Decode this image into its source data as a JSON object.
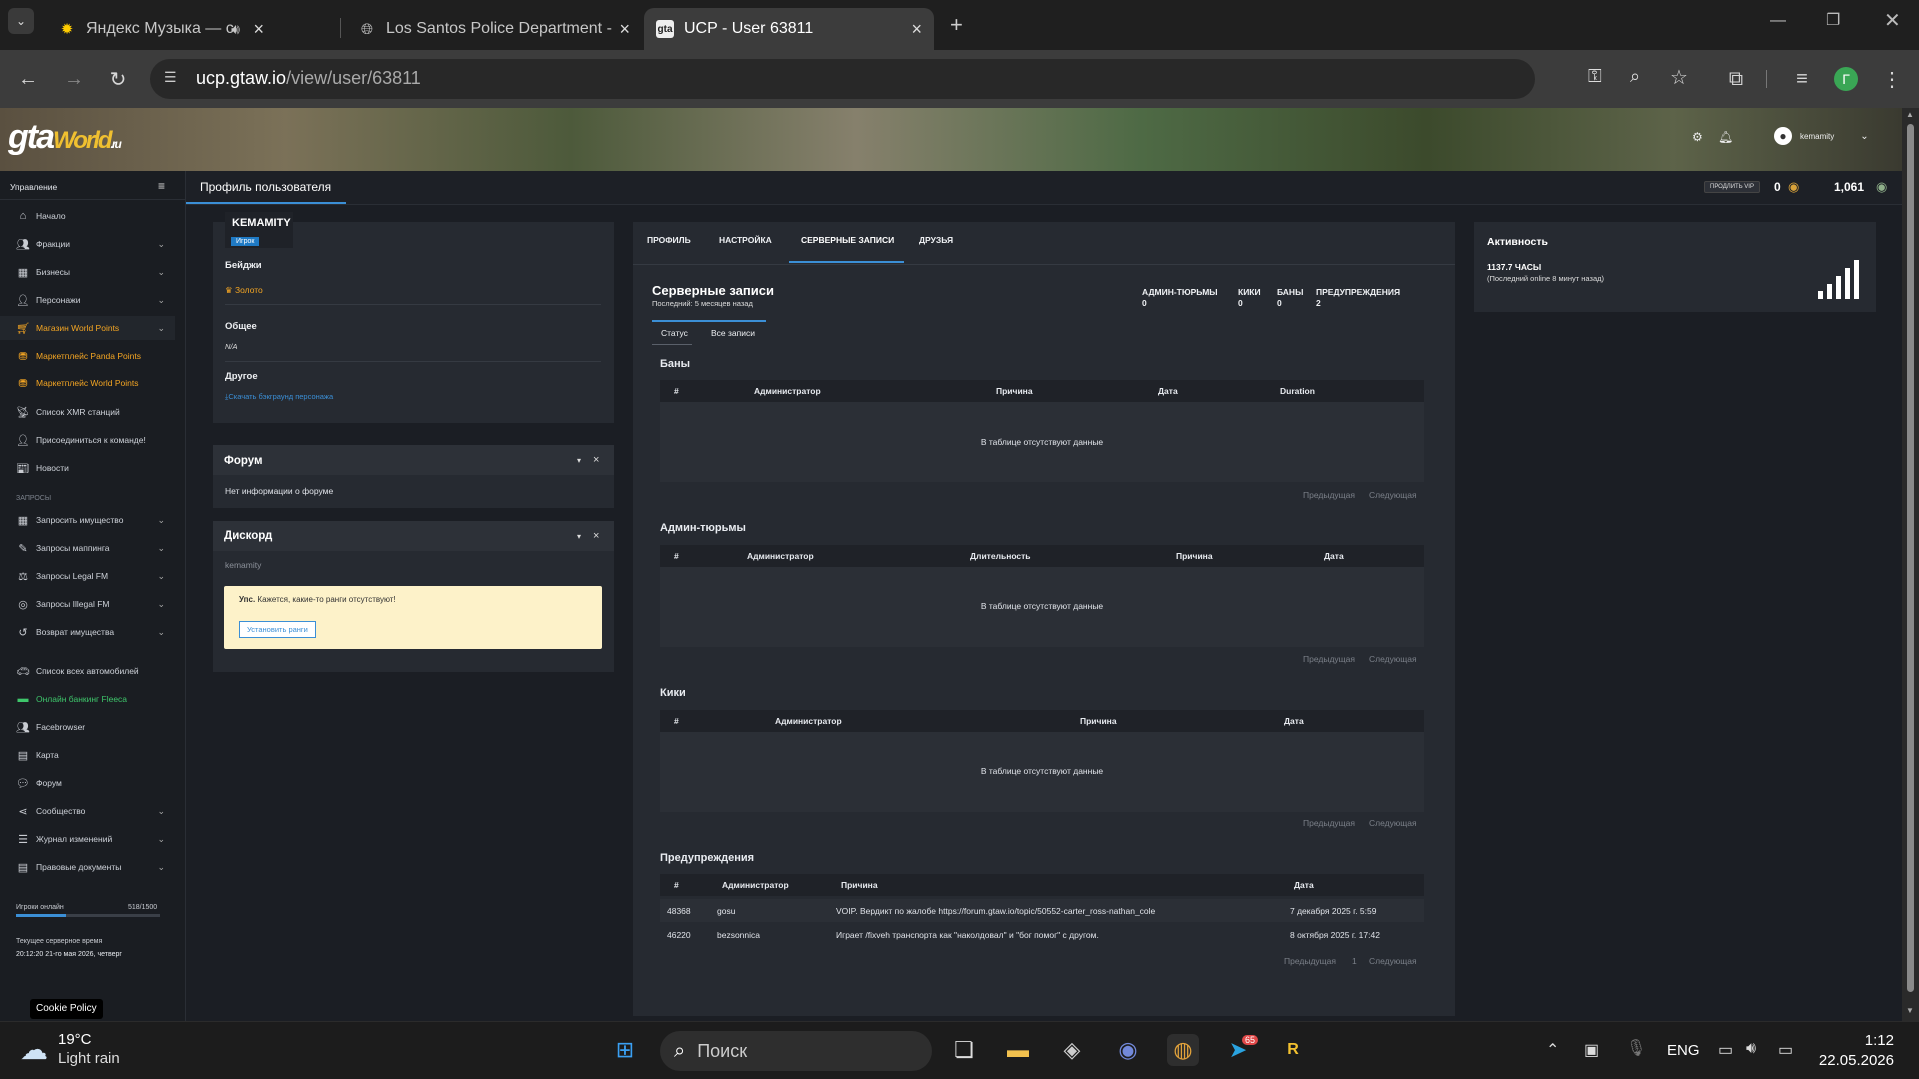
{
  "browser": {
    "tabs": [
      {
        "title": "Яндекс Музыка — собирае",
        "icon": "yandex-music-icon",
        "audio": true
      },
      {
        "title": "Los Santos Police Department -",
        "icon": "globe-icon"
      },
      {
        "title": "UCP - User 63811",
        "icon": "gta-world-icon",
        "active": true
      }
    ],
    "url_host": "ucp.gtaw.io",
    "url_path": "/view/user/63811",
    "profile_initial": "Г"
  },
  "banner": {
    "logo_main": "gta",
    "logo_sub": "World",
    "logo_tld": ".ru",
    "user_name": "kemamity"
  },
  "sidebar": {
    "header": "Управление",
    "items": [
      {
        "label": "Начало",
        "icon": "home-icon"
      },
      {
        "label": "Фракции",
        "icon": "users-icon",
        "chevron": true
      },
      {
        "label": "Бизнесы",
        "icon": "building-icon",
        "chevron": true
      },
      {
        "label": "Персонажи",
        "icon": "user-icon",
        "chevron": true
      },
      {
        "label": "Магазин World Points",
        "icon": "cart-icon",
        "chevron": true
      },
      {
        "label": "Маркетплейс Panda Points",
        "icon": "coins-icon"
      },
      {
        "label": "Маркетплейс World Points",
        "icon": "coins-icon"
      },
      {
        "label": "Список ХМR станций",
        "icon": "broadcast-icon"
      },
      {
        "label": "Присоединиться к команде!",
        "icon": "user-plus-icon"
      },
      {
        "label": "Новости",
        "icon": "newspaper-icon"
      }
    ],
    "requests_header": "ЗАПРОСЫ",
    "request_items": [
      {
        "label": "Запросить имущество",
        "icon": "building-icon",
        "chevron": true
      },
      {
        "label": "Запросы маппинга",
        "icon": "brush-icon",
        "chevron": true
      },
      {
        "label": "Запросы Legal FM",
        "icon": "scale-icon",
        "chevron": true
      },
      {
        "label": "Запросы Illegal FM",
        "icon": "mask-icon",
        "chevron": true
      },
      {
        "label": "Возврат имущества",
        "icon": "undo-icon",
        "chevron": true
      }
    ],
    "other_items": [
      {
        "label": "Список всех автомобилей",
        "icon": "car-icon"
      },
      {
        "label": "Онлайн банкинг Fleeca",
        "icon": "bank-icon"
      },
      {
        "label": "Facebrowser",
        "icon": "users-icon"
      },
      {
        "label": "Карта",
        "icon": "map-icon"
      },
      {
        "label": "Форум",
        "icon": "comments-icon"
      },
      {
        "label": "Сообщество",
        "icon": "share-icon",
        "chevron": true
      },
      {
        "label": "Журнал изменений",
        "icon": "list-icon",
        "chevron": true
      },
      {
        "label": "Правовые документы",
        "icon": "document-icon",
        "chevron": true
      }
    ],
    "players_online_label": "Игроки онлайн",
    "players_online_value": "518/1500",
    "players_online_fraction": 0.345,
    "server_time_label": "Текущее серверное время",
    "server_time_value": "20:12:20 21-го мая 2026, четверг",
    "cookie_policy": "Cookie Policy"
  },
  "topnav": {
    "title": "Профиль пользователя",
    "vip_label": "ПРОДЛИТЬ VIP",
    "points_value": "0",
    "world_points": "1,061"
  },
  "profile": {
    "username": "KEMAMITY",
    "role_badge": "Игрок",
    "badges_label": "Бейджи",
    "badge_gold": "Золото",
    "general_label": "Общее",
    "general_value": "N/A",
    "other_label": "Другое",
    "download_link": "Скачать бэкграунд персонажа"
  },
  "forum_panel": {
    "title": "Форум",
    "text": "Нет информации о форуме"
  },
  "discord_panel": {
    "title": "Дискорд",
    "user": "kemamity",
    "alert_bold": "Упс.",
    "alert_text": "Кажется, какие-то ранги отсутствуют!",
    "button": "Установить ранги"
  },
  "tabs": [
    "ПРОФИЛЬ",
    "НАСТРОЙКА",
    "СЕРВЕРНЫЕ ЗАПИСИ",
    "ДРУЗЬЯ"
  ],
  "records": {
    "title": "Серверные записи",
    "subtitle": "Последний: 5 месяцев назад",
    "stats": [
      {
        "label": "АДМИН-ТЮРЬМЫ",
        "value": "0"
      },
      {
        "label": "КИКИ",
        "value": "0"
      },
      {
        "label": "БАНЫ",
        "value": "0"
      },
      {
        "label": "ПРЕДУПРЕЖДЕНИЯ",
        "value": "2"
      }
    ],
    "subtabs": [
      "Статус",
      "Все записи"
    ],
    "no_data": "В таблице отсутствуют данные",
    "prev": "Предыдущая",
    "next": "Следующая",
    "page": "1",
    "bans": {
      "title": "Баны",
      "columns": [
        "#",
        "Администратор",
        "Причина",
        "Дата",
        "Duration"
      ]
    },
    "jails": {
      "title": "Админ-тюрьмы",
      "columns": [
        "#",
        "Администратор",
        "Длительность",
        "Причина",
        "Дата"
      ]
    },
    "kicks": {
      "title": "Кики",
      "columns": [
        "#",
        "Администратор",
        "Причина",
        "Дата"
      ]
    },
    "warnings": {
      "title": "Предупреждения",
      "columns": [
        "#",
        "Администратор",
        "Причина",
        "Дата"
      ],
      "rows": [
        {
          "id": "48368",
          "admin": "gosu",
          "reason": "VOIP. Вердикт по жалобе https://forum.gtaw.io/topic/50552-carter_ross-nathan_cole",
          "date": "7 декабря 2025 г. 5:59"
        },
        {
          "id": "46220",
          "admin": "bezsonnica",
          "reason": "Играет /fixveh транспорта как \"наколдовал\" и \"бог помог\" с другом.",
          "date": "8 октября 2025 г. 17:42"
        }
      ]
    }
  },
  "activity": {
    "title": "Активность",
    "hours": "1137.7 ЧАСЫ",
    "last_online": "(Последний online 8 минут назад)"
  },
  "taskbar": {
    "temperature": "19°C",
    "weather": "Light rain",
    "search_placeholder": "Поиск",
    "language": "ENG",
    "time": "1:12",
    "date": "22.05.2026",
    "telegram_badge": "65"
  }
}
